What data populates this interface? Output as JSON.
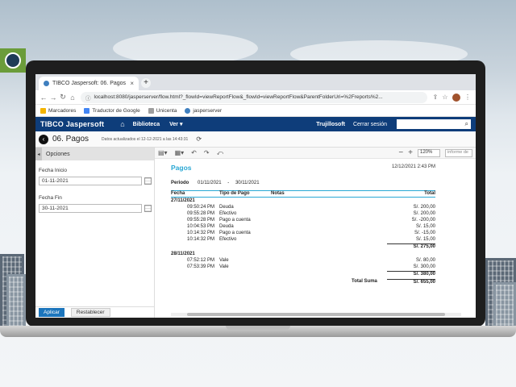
{
  "browser": {
    "tab_title": "TIBCO Jaspersoft: 06. Pagos",
    "tab_close": "×",
    "new_tab": "+",
    "url": "localhost:8080/jasperserver/flow.html?_flowId=viewReportFlow&_flowId=viewReportFlow&ParentFolderUri=%2Freports%2...",
    "bookmarks": [
      {
        "label": "Marcadores",
        "icon": "folder-icon",
        "color": "#f4b400"
      },
      {
        "label": "Traductor de Google",
        "icon": "translate-icon",
        "color": "#4285f4"
      },
      {
        "label": "Unicenta",
        "icon": "file-icon",
        "color": "#9e9e9e"
      },
      {
        "label": "jasperserver",
        "icon": "jasper-icon",
        "color": "#3f7fbf"
      }
    ]
  },
  "app": {
    "brand": "TIBCO Jaspersoft",
    "menu": [
      "Biblioteca",
      "Ver ▾"
    ],
    "user": "Trujillosoft",
    "logout": "Cerrar sesión"
  },
  "page": {
    "title": "06. Pagos",
    "info": "Datos actualizados el 12-12-2021 a las 14:43:31"
  },
  "sidebar": {
    "header": "Opciones",
    "fields": [
      {
        "label": "Fecha Inicio",
        "value": "01-11-2021"
      },
      {
        "label": "Fecha Fin",
        "value": "30-11-2021"
      }
    ],
    "apply": "Aplicar",
    "reset": "Restablecer"
  },
  "viewer": {
    "zoom": "120%",
    "report_selector": "informe de"
  },
  "report": {
    "title": "Pagos",
    "timestamp": "12/12/2021 2:43 PM",
    "period_label": "Periodo",
    "period_from": "01/11/2021",
    "period_sep": "-",
    "period_to": "30/11/2021",
    "columns": {
      "fecha": "Fecha",
      "tipo": "Tipo de Pago",
      "notas": "Notas",
      "total": "Total"
    },
    "groups": [
      {
        "date": "27/11/2021",
        "rows": [
          {
            "time": "09:50:24 PM",
            "tipo": "Deuda",
            "total": "S/. 200,00"
          },
          {
            "time": "09:55:28 PM",
            "tipo": "Efectivo",
            "total": "S/. 200,00"
          },
          {
            "time": "09:55:28 PM",
            "tipo": "Pago a cuenta",
            "total": "S/. -200,00"
          },
          {
            "time": "10:04:53 PM",
            "tipo": "Deuda",
            "total": "S/. 15,00"
          },
          {
            "time": "10:14:32 PM",
            "tipo": "Pago a cuenta",
            "total": "S/. -15,00"
          },
          {
            "time": "10:14:32 PM",
            "tipo": "Efectivo",
            "total": "S/. 15,00"
          }
        ],
        "subtotal": "S/. 275,00"
      },
      {
        "date": "28/11/2021",
        "rows": [
          {
            "time": "07:52:12 PM",
            "tipo": "Vale",
            "total": "S/. 80,00"
          },
          {
            "time": "07:53:39 PM",
            "tipo": "Vale",
            "total": "S/. 300,00"
          }
        ],
        "subtotal": "S/. 380,00"
      }
    ],
    "total_label": "Total Suma",
    "total_value": "S/. 655,00"
  }
}
